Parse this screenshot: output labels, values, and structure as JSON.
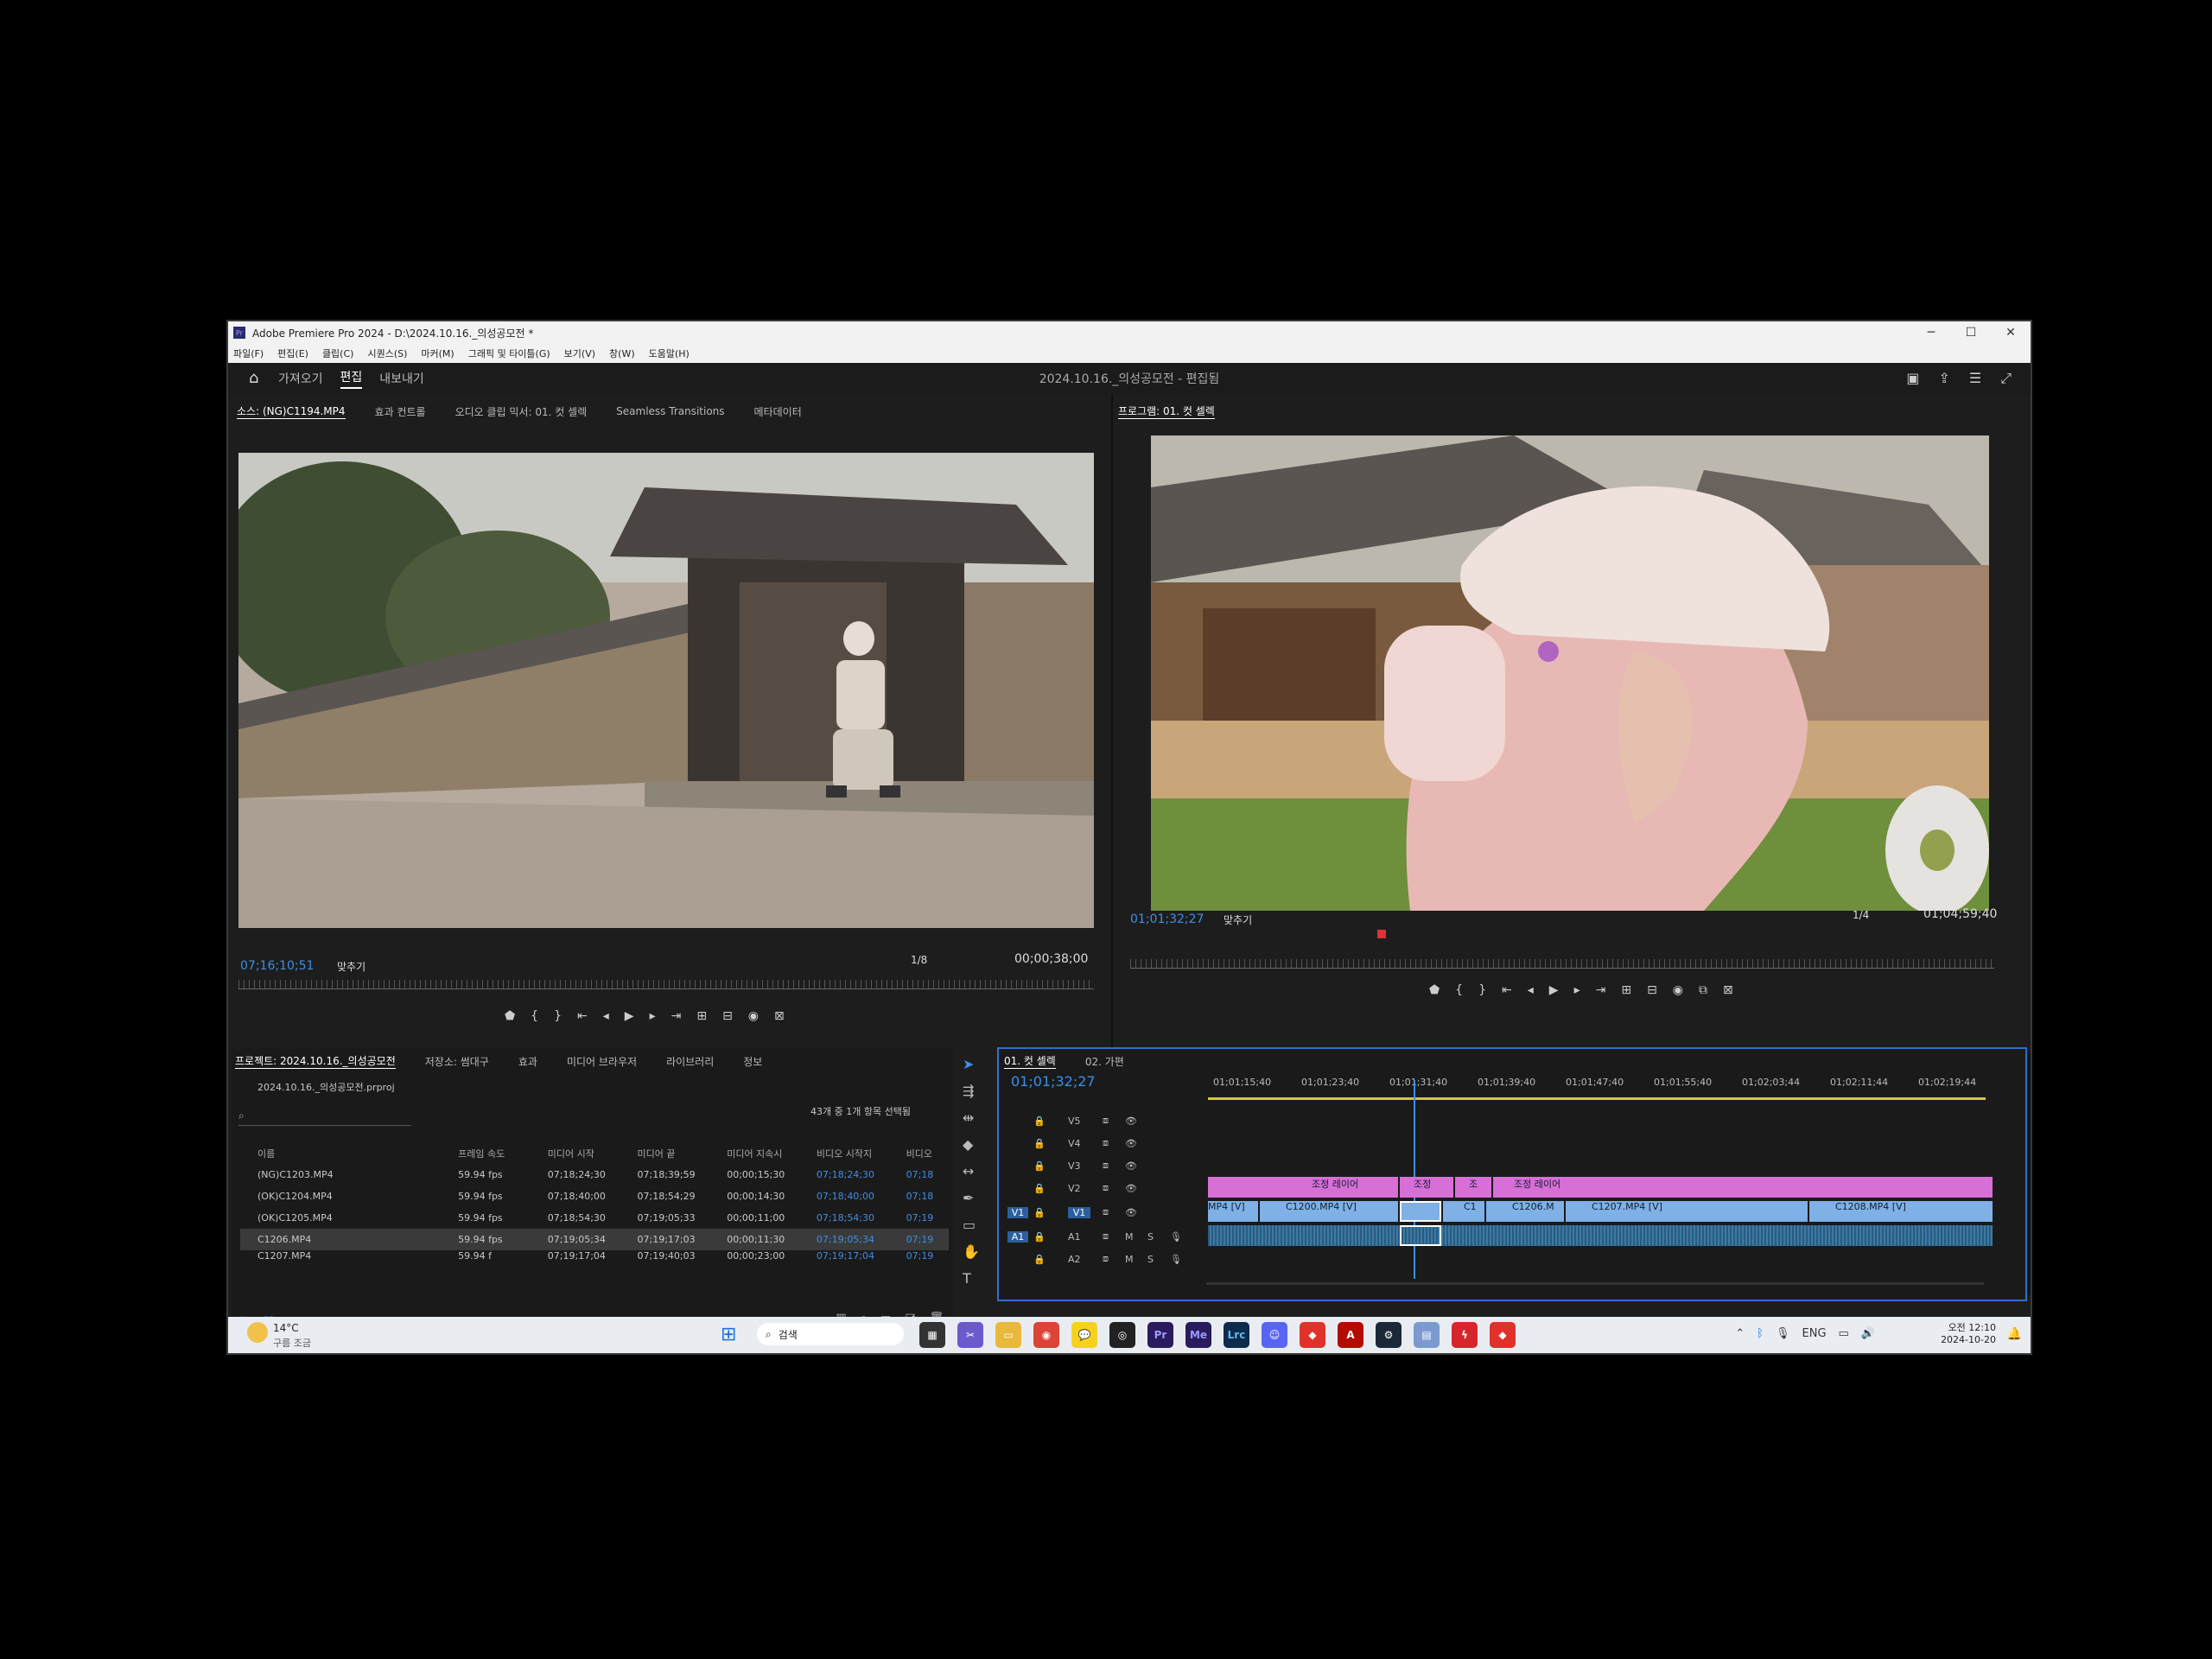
{
  "window": {
    "title": "Adobe Premiere Pro 2024 - D:\\2024.10.16._의성공모전 *",
    "controls": [
      "─",
      "☐",
      "✕"
    ]
  },
  "menu": [
    "파일(F)",
    "편집(E)",
    "클립(C)",
    "시퀀스(S)",
    "마커(M)",
    "그래픽 및 타이틀(G)",
    "보기(V)",
    "창(W)",
    "도움말(H)"
  ],
  "workspaces": [
    "가져오기",
    "편집",
    "내보내기"
  ],
  "project_title": "2024.10.16._의성공모전 - 편집됨",
  "source": {
    "tabs": [
      "소스: (NG)C1194.MP4",
      "효과 컨트롤",
      "오디오 클립 믹서: 01. 컷 셀렉",
      "Seamless Transitions",
      "메타데이터"
    ],
    "timecode": "07;16;10;51",
    "fit": "맞추기",
    "resolution": "1/8",
    "duration": "00;00;38;00"
  },
  "program": {
    "tab": "프로그램: 01. 컷 셀렉",
    "timecode": "01;01;32;27",
    "fit": "맞추기",
    "resolution": "1/4",
    "duration": "01;04;59;40"
  },
  "project": {
    "tabs": [
      "프로젝트: 2024.10.16._의성공모전",
      "저장소: 썸대구",
      "효과",
      "미디어 브라우저",
      "라이브러리",
      "정보"
    ],
    "file": "2024.10.16._의성공모전.prproj",
    "selection": "43개 중 1개 항목 선택됨",
    "columns": [
      "이름",
      "프레임 속도",
      "미디어 시작",
      "미디어 끝",
      "미디어 지속시",
      "비디오 시작지",
      "비디오"
    ],
    "rows": [
      {
        "name": "(NG)C1203.MP4",
        "fps": "59.94 fps",
        "start": "07;18;24;30",
        "end": "07;18;39;59",
        "dur": "00;00;15;30",
        "vstart": "07;18;24;30",
        "v": "07;18"
      },
      {
        "name": "(OK)C1204.MP4",
        "fps": "59.94 fps",
        "start": "07;18;40;00",
        "end": "07;18;54;29",
        "dur": "00;00;14;30",
        "vstart": "07;18;40;00",
        "v": "07;18"
      },
      {
        "name": "(OK)C1205.MP4",
        "fps": "59.94 fps",
        "start": "07;18;54;30",
        "end": "07;19;05;33",
        "dur": "00;00;11;00",
        "vstart": "07;18;54;30",
        "v": "07;19"
      },
      {
        "name": "C1206.MP4",
        "fps": "59.94 fps",
        "start": "07;19;05;34",
        "end": "07;19;17;03",
        "dur": "00;00;11;30",
        "vstart": "07;19;05;34",
        "v": "07;19"
      },
      {
        "name": "C1207.MP4",
        "fps": "59.94 f",
        "start": "07;19;17;04",
        "end": "07;19;40;03",
        "dur": "00;00;23;00",
        "vstart": "07;19;17;04",
        "v": "07;19"
      }
    ]
  },
  "timeline": {
    "tabs": [
      "01. 컷 셀렉",
      "02. 가편"
    ],
    "timecode": "01;01;32;27",
    "ruler": [
      "01;01;15;40",
      "01;01;23;40",
      "01;01;31;40",
      "01;01;39;40",
      "01;01;47;40",
      "01;01;55;40",
      "01;02;03;44",
      "01;02;11;44",
      "01;02;19;44"
    ],
    "tracks": [
      "V5",
      "V4",
      "V3",
      "V2",
      "V1",
      "A1",
      "A2"
    ],
    "adjustment_labels": [
      "조정 레이어",
      "조정",
      "조",
      "조정 레이어"
    ],
    "v1_clips": [
      "MP4 [V]",
      "C1200.MP4 [V]",
      "C1",
      "C1206.M",
      "C1207.MP4 [V]",
      "C1208.MP4 [V]"
    ],
    "track_btns": {
      "m": "M",
      "s": "S"
    }
  },
  "taskbar": {
    "weather_temp": "14°C",
    "weather_desc": "구름 조금",
    "search": "검색",
    "lang": "ENG",
    "time": "오전 12:10",
    "date": "2024-10-20"
  },
  "colors": {
    "accent": "#3d8fe6",
    "adjustment": "#d66fd6",
    "clip": "#7fb0e6"
  }
}
